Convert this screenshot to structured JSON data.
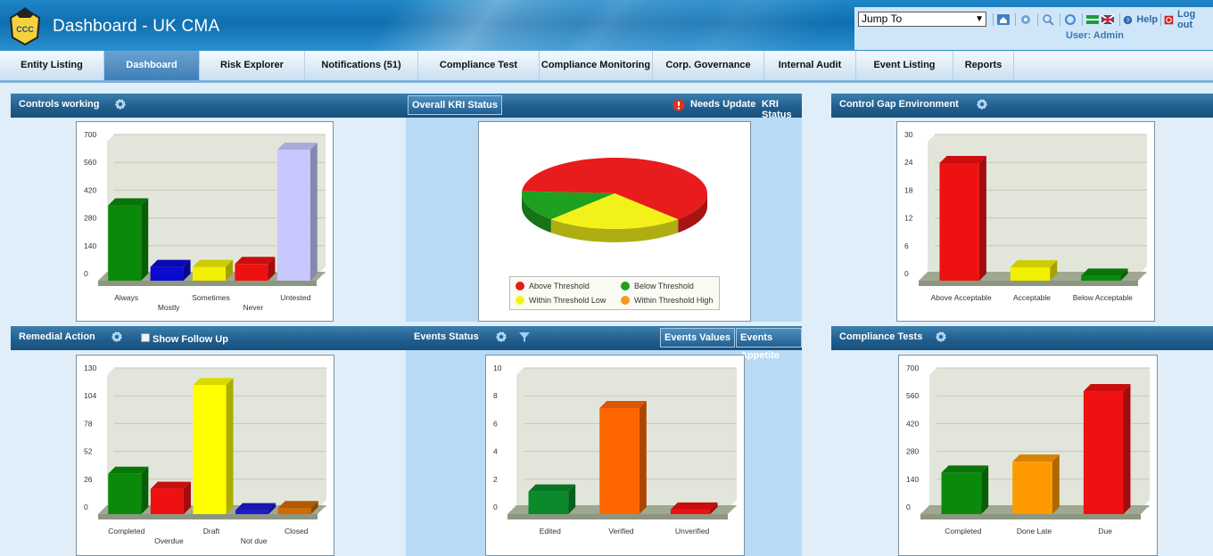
{
  "header": {
    "title": "Dashboard - UK CMA",
    "jump_to": "Jump To",
    "help": "Help",
    "logout": "Log out",
    "user": "User: Admin",
    "icons": [
      "home-icon",
      "settings-icon",
      "search-icon",
      "refresh-icon",
      "flag-icon",
      "uk-flag-icon",
      "help-icon",
      "logout-icon"
    ]
  },
  "nav": {
    "tabs": [
      {
        "label": "Entity Listing",
        "active": false
      },
      {
        "label": "Dashboard",
        "active": true
      },
      {
        "label": "Risk Explorer",
        "active": false
      },
      {
        "label": "Notifications (51)",
        "active": false
      },
      {
        "label": "Compliance Test",
        "active": false
      },
      {
        "label": "Compliance Monitoring",
        "active": false
      },
      {
        "label": "Corp. Governance",
        "active": false
      },
      {
        "label": "Internal Audit",
        "active": false
      },
      {
        "label": "Event Listing",
        "active": false
      },
      {
        "label": "Reports",
        "active": false
      }
    ]
  },
  "panels": {
    "controls_working": {
      "title": "Controls working"
    },
    "kri": {
      "title": "Overall KRI Status",
      "needs_update": "Needs Update",
      "kri_status": "KRI Status"
    },
    "control_gap": {
      "title": "Control Gap Environment"
    },
    "remedial": {
      "title": "Remedial Action",
      "show_follow_up": "Show Follow Up"
    },
    "events": {
      "title": "Events Status",
      "values_btn": "Events Values",
      "appetite_btn": "Events Appetite"
    },
    "compliance": {
      "title": "Compliance Tests"
    }
  },
  "chart_data": [
    {
      "id": "controls",
      "type": "bar",
      "title": "",
      "categories": [
        "Always",
        "Mostly",
        "Sometimes",
        "Never",
        "Untested"
      ],
      "values": [
        370,
        60,
        60,
        75,
        650
      ],
      "colors": [
        "#0a8a0a",
        "#0a0ad0",
        "#f0f000",
        "#ee1111",
        "#c8c8ff"
      ],
      "yticks": [
        0,
        140,
        280,
        420,
        560,
        700
      ],
      "ylim": [
        0,
        700
      ]
    },
    {
      "id": "kri",
      "type": "pie",
      "title": "",
      "slices": [
        {
          "label": "Above Threshold",
          "value": 62,
          "color": "#e81c1c"
        },
        {
          "label": "Within Threshold Low",
          "value": 24,
          "color": "#f2f21a"
        },
        {
          "label": "Below Threshold",
          "value": 14,
          "color": "#1fa01f"
        },
        {
          "label": "Within Threshold High",
          "value": 0,
          "color": "#f39a1e"
        }
      ],
      "legend": "bottom"
    },
    {
      "id": "gap",
      "type": "bar",
      "title": "",
      "categories": [
        "Above Acceptable",
        "Acceptable",
        "Below Acceptable"
      ],
      "values": [
        25,
        2.5,
        0.7
      ],
      "colors": [
        "#ee1111",
        "#f0f000",
        "#0a8a0a"
      ],
      "yticks": [
        0,
        6,
        12,
        18,
        24,
        30
      ],
      "ylim": [
        0,
        30
      ]
    },
    {
      "id": "remedial",
      "type": "bar",
      "title": "",
      "categories": [
        "Completed",
        "Overdue",
        "Draft",
        "Not due",
        "Closed"
      ],
      "values": [
        36,
        22,
        119,
        2,
        4
      ],
      "colors": [
        "#0a8a0a",
        "#ee1111",
        "#ffff00",
        "#1a1ad0",
        "#d16a00"
      ],
      "yticks": [
        0,
        26,
        52,
        78,
        104,
        130
      ],
      "ylim": [
        0,
        130
      ]
    },
    {
      "id": "events",
      "type": "bar",
      "title": "",
      "categories": [
        "Edited",
        "Verified",
        "Unverified"
      ],
      "values": [
        1.5,
        7.5,
        0.2
      ],
      "colors": [
        "#0a8a2a",
        "#ff6600",
        "#ee1111"
      ],
      "yticks": [
        0,
        2,
        4,
        6,
        8,
        10
      ],
      "ylim": [
        0,
        10
      ]
    },
    {
      "id": "compliance",
      "type": "bar",
      "title": "",
      "categories": [
        "Completed",
        "Done Late",
        "Due"
      ],
      "values": [
        200,
        255,
        610
      ],
      "colors": [
        "#0a8a0a",
        "#ff9900",
        "#ee1111"
      ],
      "yticks": [
        0,
        140,
        280,
        420,
        560,
        700
      ],
      "ylim": [
        0,
        700
      ]
    }
  ]
}
